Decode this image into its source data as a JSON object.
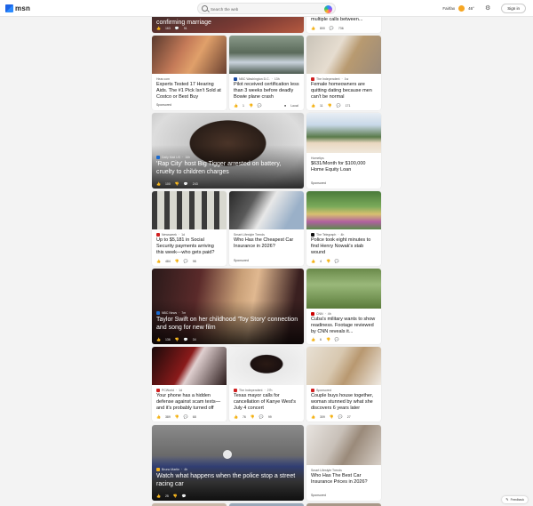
{
  "header": {
    "logo_text": "msn",
    "search_placeholder": "Search the web",
    "location": "Fairfax",
    "temperature": "46°",
    "signin_label": "Sign in"
  },
  "cards": {
    "top_left": {
      "title": "confirming marriage",
      "likes": "163",
      "comments": "51"
    },
    "top_right": {
      "title": "multiple calls between...",
      "likes": "800",
      "comments": "736"
    },
    "hearing": {
      "source": "Hear.com",
      "title": "Experts Tested 17 Hearing Aids. The #1 Pick Isn't Sold at Costco or Best Buy",
      "sponsored": "Sponsored"
    },
    "pilot": {
      "source": "NBC Washington D.C.",
      "age": "13h",
      "title": "Pilot received certification less than 3 weeks before deadly Bowie plane crash",
      "likes": "1",
      "action": "Local"
    },
    "homeowners": {
      "source": "The Independent",
      "age": "1w",
      "title": "Female homeowners are quitting dating because men can't be normal",
      "likes": "11",
      "comments": "171"
    },
    "rapcity": {
      "source": "Daily Mail US",
      "age": "16h",
      "title": "'Rap City' host Big Tigger arrested on battery, cruelty to children charges",
      "likes": "100",
      "comments": "243"
    },
    "equity": {
      "source": "Hometips",
      "title": "$631/Month for $100,000 Home Equity Loan",
      "sponsored": "Sponsored"
    },
    "social": {
      "source": "Newsweek",
      "age": "1d",
      "title": "Up to $5,181 in Social Security payments arriving this week—who gets paid?",
      "likes": "484",
      "comments": "98"
    },
    "car1": {
      "source": "Smart Lifestyle Trends",
      "title": "Who Has the Cheapest Car Insurance in 2026?",
      "sponsored": "Sponsored"
    },
    "police": {
      "source": "The Telegraph",
      "age": "4h",
      "title": "Police took eight minutes to find Henry Nowak's stab wound",
      "likes": "4",
      "comments": ""
    },
    "taylor": {
      "source": "NBC News",
      "age": "7m",
      "title": "Taylor Swift on her childhood 'Toy Story' connection and song for new film",
      "likes": "136",
      "comments": "34"
    },
    "cuba": {
      "source": "CNN",
      "age": "4h",
      "title": "Cuba's military wants to show readiness. Footage reviewed by CNN reveals it...",
      "likes": "6",
      "comments": ""
    },
    "phone": {
      "source": "PCWorld",
      "age": "1d",
      "title": "Your phone has a hidden defense against scam texts—and it's probably turned off",
      "likes": "389",
      "comments": "68"
    },
    "kanye": {
      "source": "The Independent",
      "age": "27h",
      "title": "Texas mayor calls for cancellation of Kanye West's July 4 concert",
      "likes": "76",
      "comments": "99"
    },
    "couple": {
      "source": "Sponsored",
      "title": "Couple buys house together, woman stunned by what she discovers 6 years later",
      "likes": "309",
      "comments": "27"
    },
    "street": {
      "source": "Bruno Martin",
      "age": "4h",
      "title": "Watch what happens when the police stop a street racing car",
      "likes": "25",
      "comments": ""
    },
    "car2": {
      "source": "Smart Lifestyle Trends",
      "title": "Who Has The Best Car Insurance Prices in 2026?",
      "sponsored": "Sponsored"
    }
  },
  "feedback_label": "Feedback"
}
